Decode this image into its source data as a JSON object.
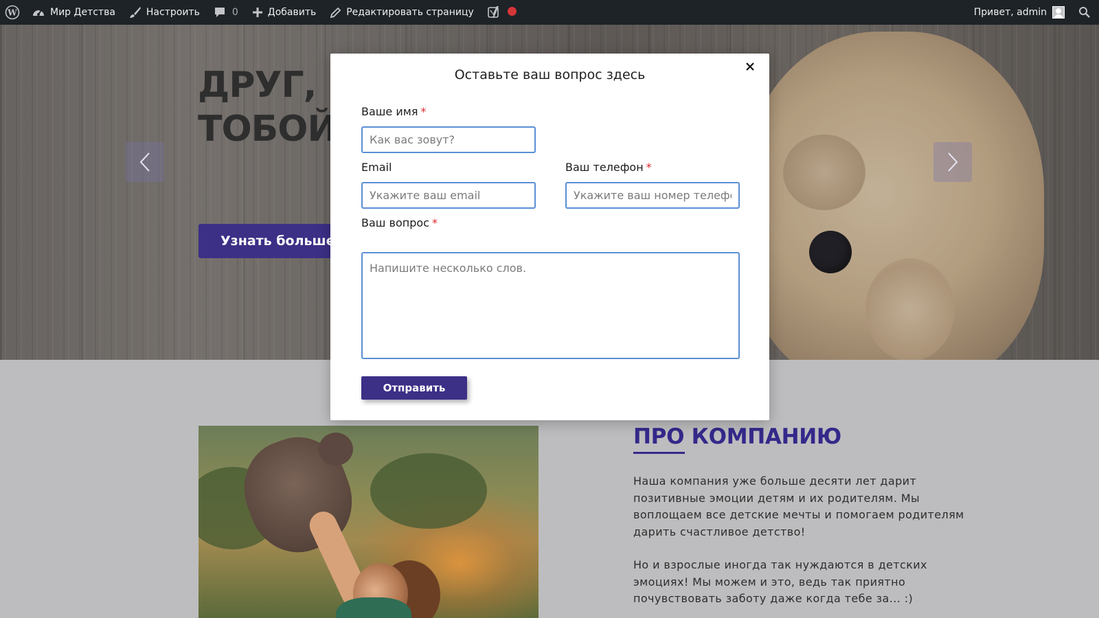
{
  "admin_bar": {
    "site_name": "Мир Детства",
    "customize": "Настроить",
    "comments_count": "0",
    "add_new": "Добавить",
    "edit_page": "Редактировать страницу",
    "greeting": "Привет, admin",
    "icons": [
      "wordpress-icon",
      "dashboard-icon",
      "brush-icon",
      "comment-icon",
      "plus-icon",
      "pencil-icon",
      "yoast-icon",
      "status-dot-icon",
      "avatar",
      "search-icon"
    ]
  },
  "hero": {
    "title": "ДРУГ, К\nТОБОЙ",
    "button_label": "Узнать больше"
  },
  "about": {
    "title": "ПРО КОМПАНИЮ",
    "paragraph1": "Наша компания уже больше десяти лет дарит позитивные эмоции детям и их родителям. Мы воплощаем все детские мечты и помогаем родителям дарить счастливое детство!",
    "paragraph2": "Но и взрослые иногда так нуждаются в детских эмоциях! Мы можем и это, ведь так приятно почувствовать заботу даже когда тебе за... :)"
  },
  "modal": {
    "title": "Оставьте ваш вопрос здесь",
    "name_label": "Ваше имя",
    "name_placeholder": "Как вас зовут?",
    "email_label": "Email",
    "email_placeholder": "Укажите ваш email",
    "phone_label": "Ваш телефон",
    "phone_placeholder": "Укажите ваш номер телефона",
    "question_label": "Ваш вопрос",
    "question_placeholder": "Напишите несколько слов.",
    "required_mark": "*",
    "submit_label": "Отправить"
  },
  "colors": {
    "admin_bar_bg": "#1d2327",
    "brand_purple": "#3c2f86",
    "input_border": "#5a8fd6",
    "required_red": "#e0262f",
    "status_dot": "#d63638"
  }
}
